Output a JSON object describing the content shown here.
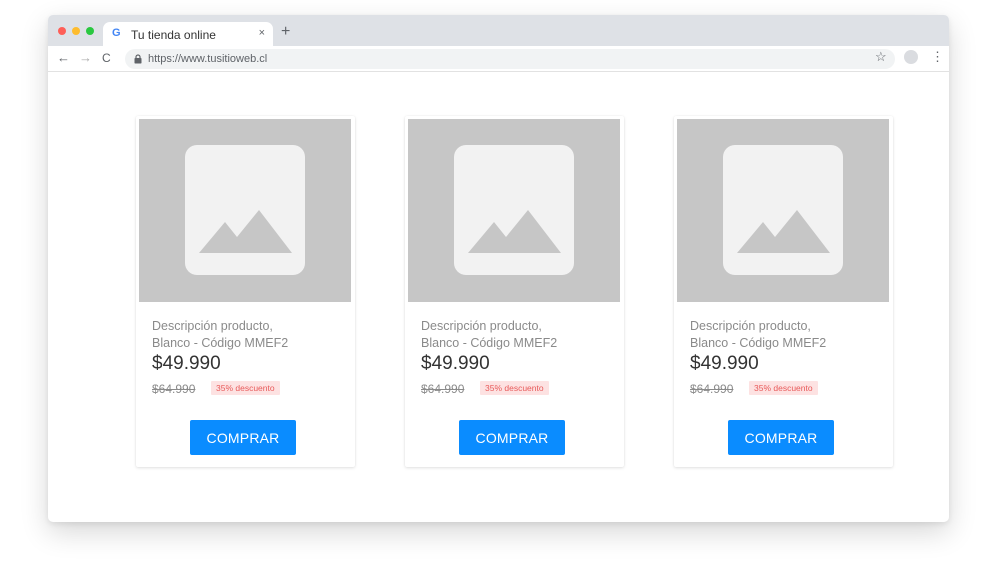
{
  "browser": {
    "tab_title": "Tu tienda online",
    "tab_favicon": "G",
    "tab_close": "×",
    "new_tab": "+",
    "url": "https://www.tusitioweb.cl",
    "icons": {
      "back": "←",
      "forward": "→",
      "reload": "C",
      "star": "☆",
      "menu": "⋮"
    }
  },
  "products": [
    {
      "description_line1": "Descripción producto,",
      "description_line2": "Blanco - Código MMEF2",
      "price": "$49.990",
      "old_price": "$64.990",
      "discount": "35% descuento",
      "button": "COMPRAR"
    },
    {
      "description_line1": "Descripción producto,",
      "description_line2": "Blanco - Código MMEF2",
      "price": "$49.990",
      "old_price": "$64.990",
      "discount": "35% descuento",
      "button": "COMPRAR"
    },
    {
      "description_line1": "Descripción producto,",
      "description_line2": "Blanco - Código MMEF2",
      "price": "$49.990",
      "old_price": "$64.990",
      "discount": "35% descuento",
      "button": "COMPRAR"
    }
  ],
  "colors": {
    "accent": "#0a8cff",
    "discount_bg": "#fde2e2",
    "discount_text": "#e85a5a",
    "image_placeholder": "#c6c6c6"
  }
}
